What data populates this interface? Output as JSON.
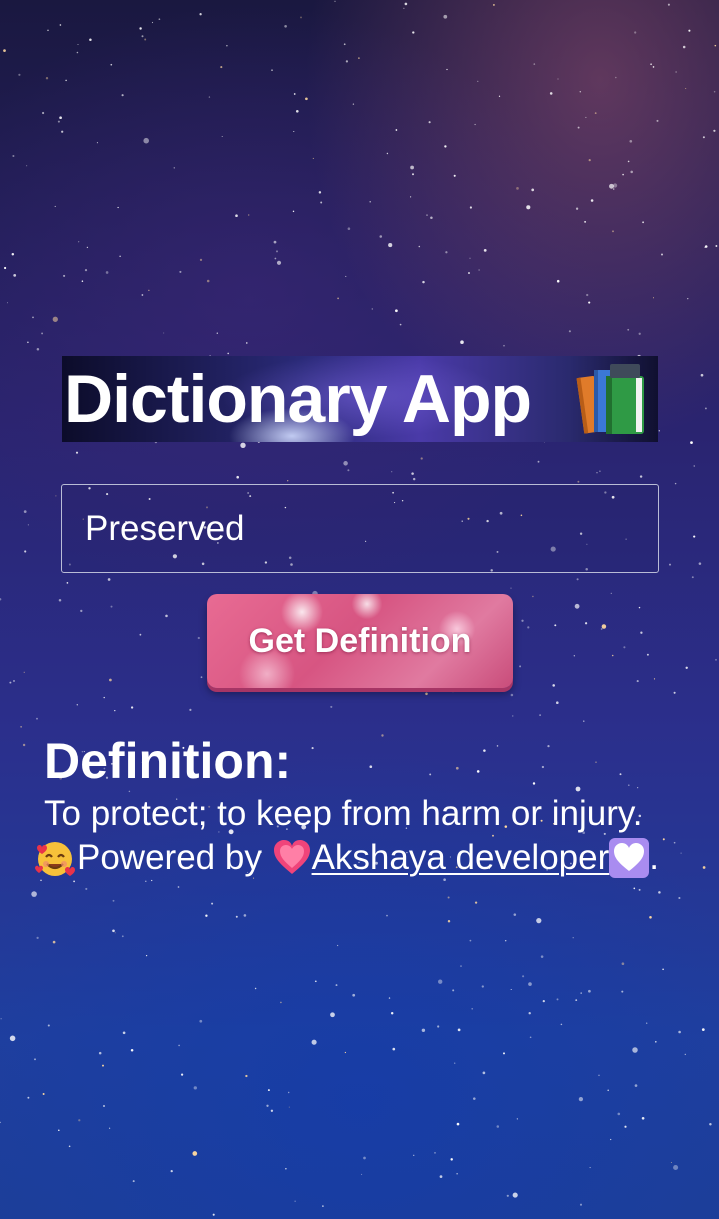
{
  "header": {
    "title": "Dictionary App",
    "title_icon": "books-icon"
  },
  "search": {
    "value": "Preserved",
    "placeholder": ""
  },
  "actions": {
    "get_definition_label": "Get Definition"
  },
  "result": {
    "heading": "Definition:",
    "text": "To protect; to keep from harm or injury."
  },
  "footer": {
    "powered_prefix": "Powered by",
    "developer_link": " Akshaya developer ",
    "trailing": ".",
    "prefix_icon": "smiling-face-with-hearts-icon",
    "link_left_icon": "growing-heart-icon",
    "link_right_icon": "white-heart-icon"
  },
  "colors": {
    "button_pink": "#d75582",
    "background_top": "#1a1840",
    "background_bottom": "#1d3e98",
    "text": "#ffffff"
  }
}
